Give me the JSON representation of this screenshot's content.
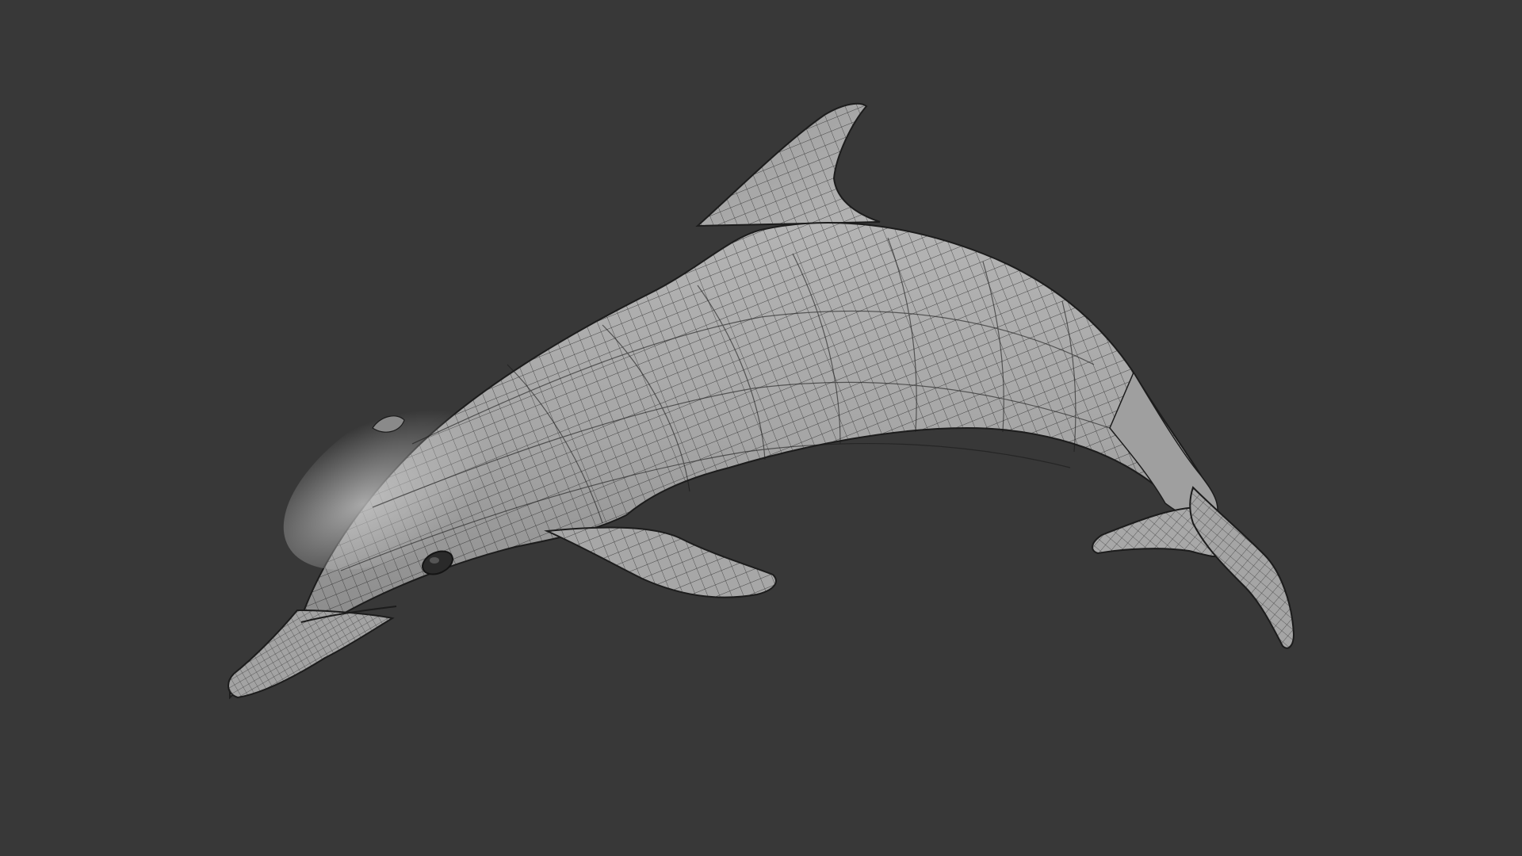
{
  "viewport": {
    "background_color": "#383838",
    "model_name_icon": "dolphin-wireframe-model",
    "shading": "solid-gray-with-wireframe",
    "mesh_color": "#a9a9a9",
    "wire_color": "#1e1e1e"
  }
}
